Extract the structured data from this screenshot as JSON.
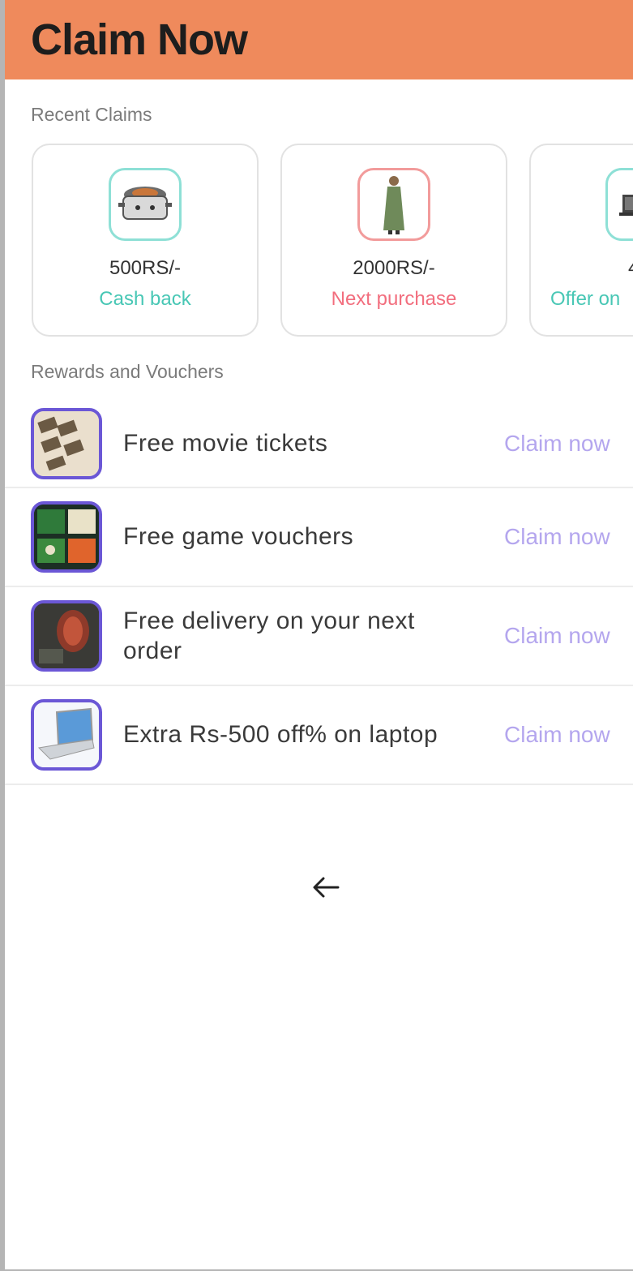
{
  "header": {
    "title": "Claim Now"
  },
  "recent": {
    "label": "Recent Claims",
    "cards": [
      {
        "amount": "500RS/-",
        "subtitle": "Cash back",
        "icon": "cooker-icon"
      },
      {
        "amount": "2000RS/-",
        "subtitle": "Next purchase",
        "icon": "dress-icon"
      },
      {
        "amount": "4",
        "subtitle": "Offer on",
        "icon": "device-icon"
      }
    ]
  },
  "rewards": {
    "label": "Rewards and Vouchers",
    "items": [
      {
        "text": "Free movie tickets",
        "action": "Claim now",
        "icon": "movie-ticket-icon"
      },
      {
        "text": "Free game vouchers",
        "action": "Claim now",
        "icon": "game-voucher-icon"
      },
      {
        "text": "Free delivery on your next order",
        "action": "Claim now",
        "icon": "delivery-icon"
      },
      {
        "text": "Extra Rs-500 off% on laptop",
        "action": "Claim now",
        "icon": "laptop-icon"
      }
    ]
  },
  "nav": {
    "back_icon": "arrow-left-icon"
  },
  "colors": {
    "header_bg": "#ef8a5c",
    "teal": "#48c7b5",
    "pink": "#f26e7e",
    "purple_border": "#6b57d6",
    "claim_text": "#b4a6ee"
  }
}
